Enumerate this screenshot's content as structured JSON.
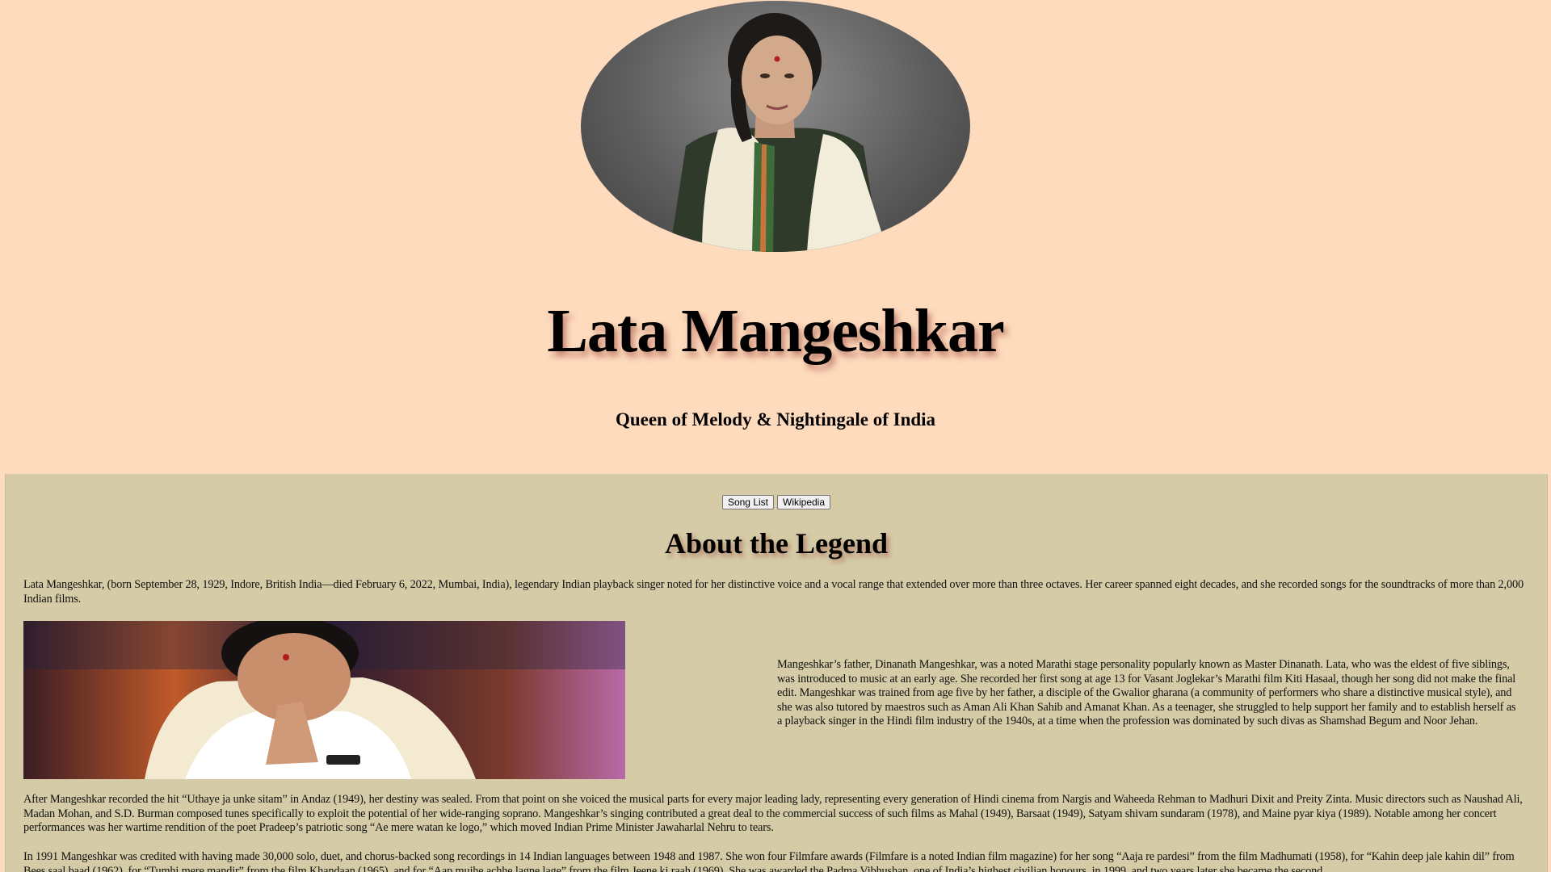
{
  "header": {
    "title": "Lata Mangeshkar",
    "tagline": "Queen of Melody & Nightingale of India"
  },
  "nav": {
    "song_list_label": "Song List",
    "wikipedia_label": "Wikipedia"
  },
  "about": {
    "heading": "About the Legend",
    "paragraph_1": "Lata Mangeshkar, (born September 28, 1929, Indore, British India—died February 6, 2022, Mumbai, India), legendary Indian playback singer noted for her distinctive voice and a vocal range that extended over more than three octaves. Her career spanned eight decades, and she recorded songs for the soundtracks of more than 2,000 Indian films.",
    "paragraph_2": "Mangeshkar’s father, Dinanath Mangeshkar, was a noted Marathi stage personality popularly known as Master Dinanath. Lata, who was the eldest of five siblings, was introduced to music at an early age. She recorded her first song at age 13 for Vasant Joglekar’s Marathi film Kiti Hasaal, though her song did not make the final edit. Mangeshkar was trained from age five by her father, a disciple of the Gwalior gharana (a community of performers who share a distinctive musical style), and she was also tutored by maestros such as Aman Ali Khan Sahib and Amanat Khan. As a teenager, she struggled to help support her family and to establish herself as a playback singer in the Hindi film industry of the 1940s, at a time when the profession was dominated by such divas as Shamshad Begum and Noor Jehan.",
    "paragraph_3": "After Mangeshkar recorded the hit “Uthaye ja unke sitam” in Andaz (1949), her destiny was sealed. From that point on she voiced the musical parts for every major leading lady, representing every generation of Hindi cinema from Nargis and Waheeda Rehman to Madhuri Dixit and Preity Zinta. Music directors such as Naushad Ali, Madan Mohan, and S.D. Burman composed tunes specifically to exploit the potential of her wide-ranging soprano. Mangeshkar’s singing contributed a great deal to the commercial success of such films as Mahal (1949), Barsaat (1949), Satyam shivam sundaram (1978), and Maine pyar kiya (1989). Notable among her concert performances was her wartime rendition of the poet Pradeep’s patriotic song “Ae mere watan ke logo,” which moved Indian Prime Minister Jawaharlal Nehru to tears.",
    "paragraph_4": "In 1991 Mangeshkar was credited with having made 30,000 solo, duet, and chorus-backed song recordings in 14 Indian languages between 1948 and 1987. She won four Filmfare awards (Filmfare is a noted Indian film magazine) for her song “Aaja re pardesi” from the film Madhumati (1958), for “Kahin deep jale kahin dil” from Bees saal baad (1962), for “Tumhi mere mandir” from the film Khandaan (1965), and for “Aap mujhe achhe lagne lage” from the film Jeene ki raah (1969). She was awarded the Padma Vibhushan, one of India’s highest civilian honours, in 1999, and two years later she became the second"
  },
  "colors": {
    "header_bg": "#fedbbd",
    "main_bg": "#d5cba6",
    "title_shadow": "#963c32"
  }
}
